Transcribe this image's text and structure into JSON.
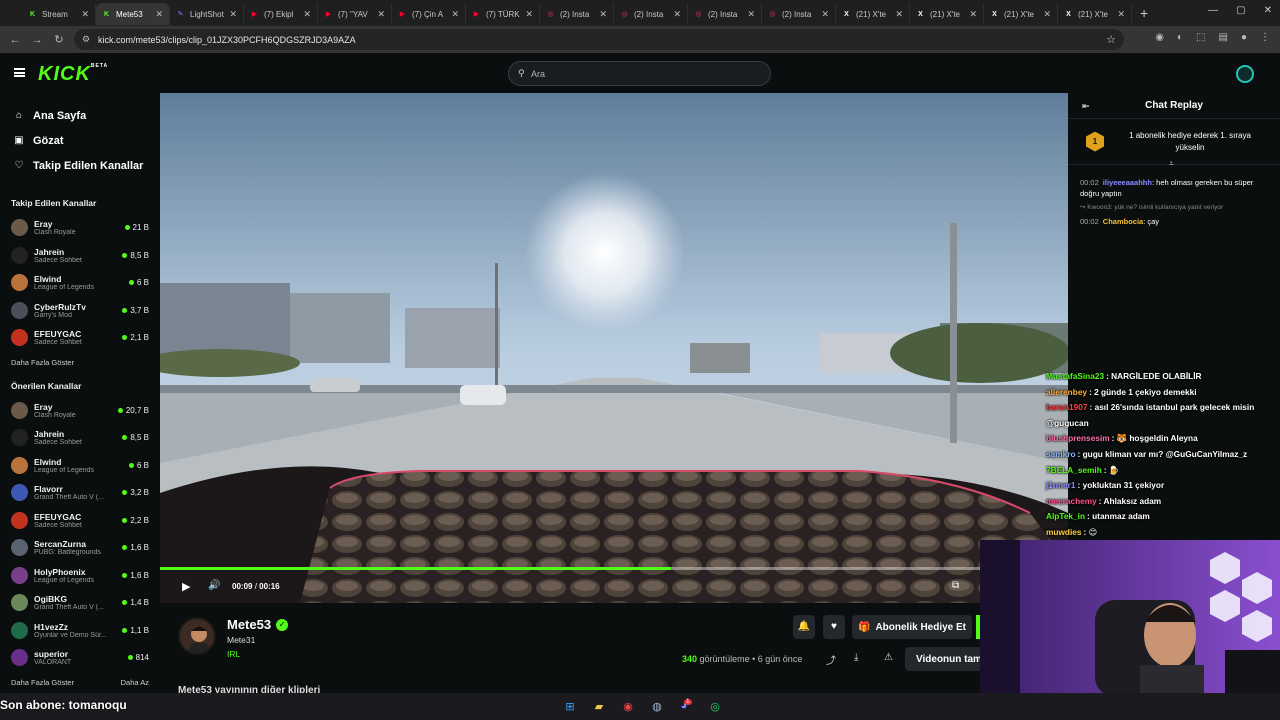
{
  "browser": {
    "tabs": [
      {
        "label": "Stream",
        "icon": "kick-icon",
        "color": "#53fc18"
      },
      {
        "label": "Mete53",
        "icon": "kick-icon",
        "color": "#53fc18",
        "active": true
      },
      {
        "label": "LightShot",
        "icon": "lightshot-icon",
        "color": "#a066ff"
      },
      {
        "label": "(7) Ekipl",
        "icon": "youtube-icon",
        "color": "#ff0033"
      },
      {
        "label": "(7) \"YAV",
        "icon": "youtube-icon",
        "color": "#ff0033"
      },
      {
        "label": "(7) Çin A",
        "icon": "youtube-icon",
        "color": "#ff0033"
      },
      {
        "label": "(7) TÜRK",
        "icon": "youtube-icon",
        "color": "#ff0033"
      },
      {
        "label": "(2) Insta",
        "icon": "instagram-icon",
        "color": "#e1306c"
      },
      {
        "label": "(2) Insta",
        "icon": "instagram-icon",
        "color": "#e1306c"
      },
      {
        "label": "(2) Insta",
        "icon": "instagram-icon",
        "color": "#e1306c"
      },
      {
        "label": "(2) Insta",
        "icon": "instagram-icon",
        "color": "#e1306c"
      },
      {
        "label": "(21) X'te",
        "icon": "x-icon",
        "color": "#ffffff"
      },
      {
        "label": "(21) X'te",
        "icon": "x-icon",
        "color": "#ffffff"
      },
      {
        "label": "(21) X'te",
        "icon": "x-icon",
        "color": "#ffffff"
      },
      {
        "label": "(21) X'te",
        "icon": "x-icon",
        "color": "#ffffff"
      }
    ],
    "url": "kick.com/mete53/clips/clip_01JZX30PCFH6QDGSZRJD3A9AZA"
  },
  "header": {
    "logo": "KICK",
    "logo_badge": "BETA",
    "search_placeholder": "Ara"
  },
  "nav": [
    {
      "label": "Ana Sayfa",
      "icon": "home-icon"
    },
    {
      "label": "Gözat",
      "icon": "browse-icon"
    },
    {
      "label": "Takip Edilen Kanallar",
      "icon": "heart-icon"
    }
  ],
  "followed": {
    "title": "Takip Edilen Kanallar",
    "channels": [
      {
        "name": "Eray",
        "game": "Clash Royale",
        "viewers": "21 B",
        "color": "#6b5a4a"
      },
      {
        "name": "Jahrein",
        "game": "Sadece Sohbet",
        "viewers": "8,5 B",
        "color": "#222"
      },
      {
        "name": "Elwind",
        "game": "League of Legends",
        "viewers": "6 B",
        "color": "#b9733a"
      },
      {
        "name": "CyberRulzTv",
        "game": "Garry's Mod",
        "viewers": "3,7 B",
        "color": "#4a4f5a"
      },
      {
        "name": "EFEUYGAC",
        "game": "Sadece Sohbet",
        "viewers": "2,1 B",
        "color": "#c2321f"
      }
    ],
    "more": "Daha Fazla Göster"
  },
  "recommended": {
    "title": "Önerilen Kanallar",
    "channels": [
      {
        "name": "Eray",
        "game": "Clash Royale",
        "viewers": "20,7 B",
        "color": "#6b5a4a"
      },
      {
        "name": "Jahrein",
        "game": "Sadece Sohbet",
        "viewers": "8,5 B",
        "color": "#222"
      },
      {
        "name": "Elwind",
        "game": "League of Legends",
        "viewers": "6 B",
        "color": "#b9733a"
      },
      {
        "name": "Flavorr",
        "game": "Grand Theft Auto V (...",
        "viewers": "3,2 B",
        "color": "#3e58b8"
      },
      {
        "name": "EFEUYGAC",
        "game": "Sadece Sohbet",
        "viewers": "2,2 B",
        "color": "#c2321f"
      },
      {
        "name": "SercanZurna",
        "game": "PUBG: Battlegrounds",
        "viewers": "1,6 B",
        "color": "#5a6470"
      },
      {
        "name": "HolyPhoenix",
        "game": "League of Legends",
        "viewers": "1,6 B",
        "color": "#7a3f8a"
      },
      {
        "name": "OgiBKG",
        "game": "Grand Theft Auto V (...",
        "viewers": "1,4 B",
        "color": "#6a8a5a"
      },
      {
        "name": "H1vezZz",
        "game": "Oyunlar ve Demo Sür...",
        "viewers": "1,1 B",
        "color": "#1f6b4a"
      },
      {
        "name": "superior",
        "game": "VALORANT",
        "viewers": "814",
        "color": "#6a2f8a"
      }
    ],
    "more": "Daha Fazla Göster",
    "less": "Daha Az"
  },
  "player": {
    "current_time": "00:09",
    "separator": "/",
    "duration": "00:16",
    "progress": 0.5625
  },
  "channel": {
    "name": "Mete53",
    "subtitle": "Mete31",
    "category": "IRL",
    "gift_label": "Abonelik Hediye Et",
    "views_count": "340",
    "views_label": "görüntüleme",
    "dot": "•",
    "age": "6 gün önce",
    "clip_button": "Videonun tam",
    "other_clips": "Mete53 yayınının diğer klipleri"
  },
  "chat": {
    "title": "Chat Replay",
    "goal_badge": "1",
    "goal_text": "1 abonelik hediye ederek 1. sıraya yükselin",
    "messages": [
      {
        "time": "00:02",
        "user": "iliyeeeaaahhh",
        "color": "#8f8cff",
        "text": ": heh olması gereken bu süper doğru yaptın"
      },
      {
        "reply": "Kwoon3: yük ne? isimli kullanıcıya yanıt veriyor"
      },
      {
        "time": "00:02",
        "user": "Chambocia",
        "color": "#f2c230",
        "text": ": çay"
      }
    ]
  },
  "overlay_chat": [
    {
      "user": "MustafaSina23",
      "color": "#53fc18",
      "text": ": NARGİLEDE OLABİLİR"
    },
    {
      "user": "alierenbey",
      "color": "#ffb040",
      "text": ": 2 günde 1 çekiyo demekki"
    },
    {
      "user": "barun1907",
      "color": "#ff4040",
      "text": ": asıl 26'sında istanbul park gelecek misin @gugucan"
    },
    {
      "user": "blushprensesim",
      "color": "#ff6fa8",
      "text": ": 🐯 hoşgeldin Aleyna"
    },
    {
      "user": "samkro",
      "color": "#8fb8ff",
      "text": ": gugu kliman var mı? @GuGuCanYilmaz_z"
    },
    {
      "user": "7BELA_semih",
      "color": "#53fc18",
      "text": ": 🍺"
    },
    {
      "user": "j1nner1",
      "color": "#8f8cff",
      "text": ": yokluktan 31 çekiyor"
    },
    {
      "user": "meerachemy",
      "color": "#ff4f8a",
      "text": ": Ahlaksız adam"
    },
    {
      "user": "AlpTek_in",
      "color": "#53fc18",
      "text": ": utanmaz adam"
    },
    {
      "user": "muwdies",
      "color": "#ffd040",
      "text": ": 😊"
    }
  ],
  "stream_overlay": {
    "last_sub": "Son abone: tomanoqu"
  },
  "taskbar": {
    "icons": [
      "windows-icon",
      "folder-icon",
      "chrome-icon",
      "steam-icon",
      "discord-icon",
      "spotify-icon"
    ],
    "discord_badge": "1"
  }
}
